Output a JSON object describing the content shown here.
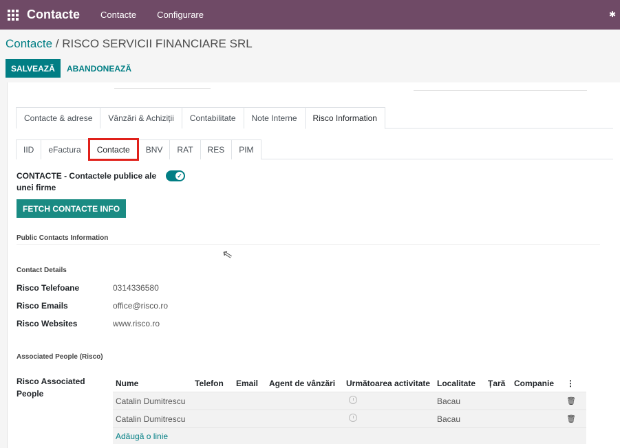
{
  "navbar": {
    "app_name": "Contacte",
    "menu": [
      "Contacte",
      "Configurare"
    ],
    "bug_icon": "bug-icon"
  },
  "breadcrumb": {
    "parent": "Contacte",
    "separator": " / ",
    "current": "RISCO SERVICII FINANCIARE SRL"
  },
  "actions": {
    "save": "SALVEAZĂ",
    "discard": "ABANDONEAZĂ"
  },
  "tabs": [
    "Contacte & adrese",
    "Vânzări & Achiziții",
    "Contabilitate",
    "Note Interne",
    "Risco Information"
  ],
  "subtabs": [
    "IID",
    "eFactura",
    "Contacte",
    "BNV",
    "RAT",
    "RES",
    "PIM"
  ],
  "form": {
    "toggle_label": "CONTACTE - Contactele publice ale unei firme",
    "toggle_on": true,
    "fetch_button": "FETCH CONTACTE INFO",
    "section_public": "Public Contacts Information",
    "section_details": "Contact Details",
    "fields": [
      {
        "label": "Risco Telefoane",
        "value": "0314336580"
      },
      {
        "label": "Risco Emails",
        "value": "office@risco.ro"
      },
      {
        "label": "Risco Websites",
        "value": "www.risco.ro"
      }
    ],
    "section_people": "Associated People (Risco)",
    "people_label": "Risco Associated People"
  },
  "table": {
    "headers": [
      "Nume",
      "Telefon",
      "Email",
      "Agent de vânzări",
      "Următoarea activitate",
      "Localitate",
      "Țară",
      "Companie"
    ],
    "rows": [
      {
        "name": "Catalin Dumitrescu",
        "localitate": "Bacau"
      },
      {
        "name": "Catalin Dumitrescu",
        "localitate": "Bacau"
      }
    ],
    "add_line": "Adăugă o linie"
  },
  "colors": {
    "navbar": "#6f4a66",
    "primary": "#017e84",
    "highlight": "#e0201a"
  }
}
